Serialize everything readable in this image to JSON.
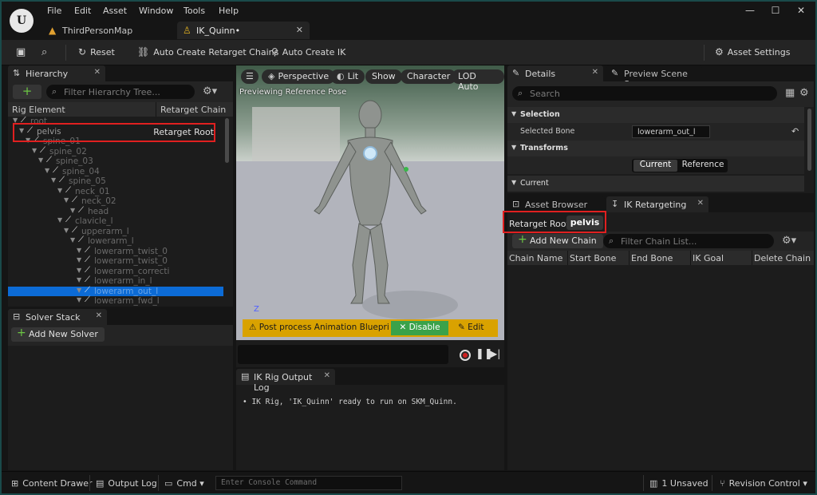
{
  "menu": [
    "File",
    "Edit",
    "Asset",
    "Window",
    "Tools",
    "Help"
  ],
  "doc_tabs": [
    {
      "label": "ThirdPersonMap"
    },
    {
      "label": "IK_Quinn•"
    }
  ],
  "toolbar": {
    "reset": "Reset",
    "auto_create_chains": "Auto Create Retarget Chains",
    "auto_create_ik": "Auto Create IK",
    "asset_settings": "Asset Settings"
  },
  "hierarchy": {
    "tab": "Hierarchy",
    "search_placeholder": "Filter Hierarchy Tree...",
    "col_rig_element": "Rig Element",
    "col_retarget_chain": "Retarget Chain",
    "retarget_root_label": "Retarget Root",
    "bones": [
      "root",
      "pelvis",
      "spine_01",
      "spine_02",
      "spine_03",
      "spine_04",
      "spine_05",
      "neck_01",
      "neck_02",
      "head",
      "clavicle_l",
      "upperarm_l",
      "lowerarm_l",
      "lowerarm_twist_0",
      "lowerarm_twist_0",
      "lowerarm_correcti",
      "lowerarm_in_l",
      "lowerarm_out_l",
      "lowerarm_fwd_l"
    ]
  },
  "solver_stack": {
    "tab": "Solver Stack",
    "add_button": "Add New Solver"
  },
  "viewport": {
    "perspective": "Perspective",
    "lit": "Lit",
    "show": "Show",
    "character": "Character",
    "lod": "LOD Auto",
    "caption": "Previewing Reference Pose",
    "axis": "Z",
    "warning": "Post process Animation Blueprint",
    "disable": "Disable",
    "edit": "Edit"
  },
  "output_log": {
    "tab": "IK Rig Output Log",
    "line": "• IK Rig, 'IK_Quinn' ready to run on SKM_Quinn."
  },
  "details": {
    "tab": "Details",
    "tab2": "Preview Scene S...",
    "search_placeholder": "Search",
    "section_selection": "Selection",
    "selected_bone_label": "Selected Bone",
    "selected_bone_value": "lowerarm_out_l",
    "section_transforms": "Transforms",
    "current_btn": "Current",
    "reference_btn": "Reference",
    "current_row": "Current"
  },
  "ik_retargeting": {
    "tab_asset_browser": "Asset Browser",
    "tab": "IK Retargeting",
    "retarget_root_label": "Retarget Root:",
    "retarget_root_value": "pelvis",
    "add_chain": "Add New Chain",
    "filter_placeholder": "Filter Chain List...",
    "columns": [
      "Chain Name",
      "Start Bone",
      "End Bone",
      "IK Goal",
      "Delete Chain"
    ]
  },
  "statusbar": {
    "content_drawer": "Content Drawer",
    "output_log": "Output Log",
    "cmd": "Cmd",
    "console_placeholder": "Enter Console Command",
    "unsaved": "1 Unsaved",
    "revision_control": "Revision Control"
  }
}
